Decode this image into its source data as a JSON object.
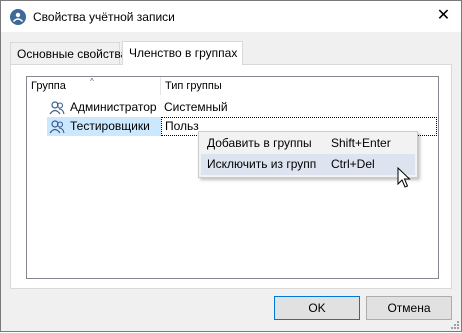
{
  "window": {
    "title": "Свойства учётной записи",
    "close_glyph": "✕"
  },
  "tabs": [
    {
      "label": "Основные свойства",
      "active": false
    },
    {
      "label": "Членство в группах",
      "active": true
    }
  ],
  "list": {
    "columns": [
      "Группа",
      "Тип группы"
    ],
    "rows": [
      {
        "icon": "group-icon",
        "name": "Администратор",
        "type": "Системный",
        "selected": false
      },
      {
        "icon": "group-icon",
        "name": "Тестировщики",
        "type": "Польз",
        "selected": true
      }
    ]
  },
  "context_menu": {
    "items": [
      {
        "label": "Добавить в группы",
        "shortcut": "Shift+Enter",
        "highlighted": false
      },
      {
        "label": "Исключить из групп",
        "shortcut": "Ctrl+Del",
        "highlighted": true
      }
    ]
  },
  "buttons": {
    "ok": "OK",
    "cancel": "Отмена"
  },
  "colors": {
    "selection": "#cce8ff",
    "menu_highlight": "#dde4f0",
    "default_button_border": "#0078d7"
  }
}
